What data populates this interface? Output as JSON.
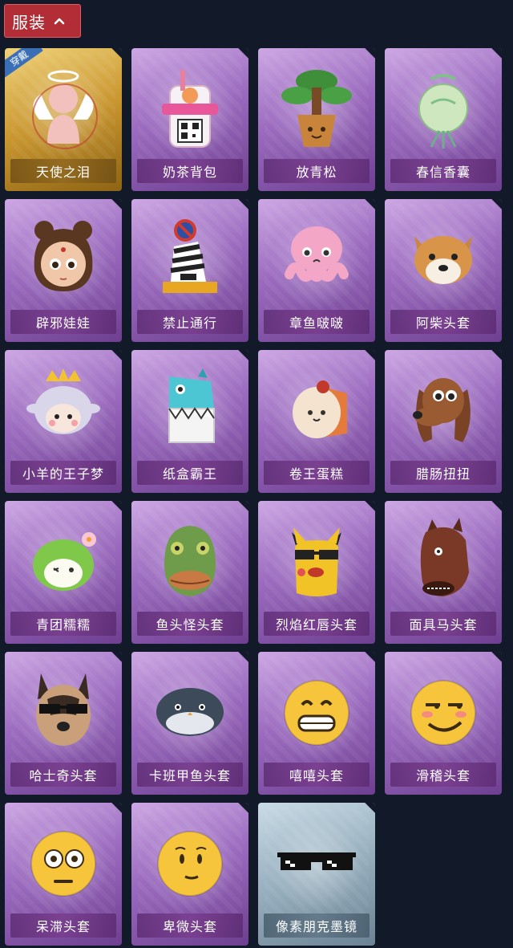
{
  "section": {
    "title": "服装",
    "icon": "chevron-up-icon"
  },
  "equipped_badge": "穿戴",
  "items": [
    {
      "label": "天使之泪",
      "icon": "angel-icon",
      "rarity": "gold",
      "equipped": true
    },
    {
      "label": "奶茶背包",
      "icon": "milk-tea-backpack-icon",
      "rarity": "purple"
    },
    {
      "label": "放青松",
      "icon": "pine-bonsai-icon",
      "rarity": "purple"
    },
    {
      "label": "春信香囊",
      "icon": "sachet-icon",
      "rarity": "purple"
    },
    {
      "label": "辟邪娃娃",
      "icon": "doll-icon",
      "rarity": "purple"
    },
    {
      "label": "禁止通行",
      "icon": "traffic-barrier-icon",
      "rarity": "purple"
    },
    {
      "label": "章鱼啵啵",
      "icon": "octopus-icon",
      "rarity": "purple"
    },
    {
      "label": "阿柴头套",
      "icon": "shiba-head-icon",
      "rarity": "purple"
    },
    {
      "label": "小羊的王子梦",
      "icon": "sheep-prince-icon",
      "rarity": "purple"
    },
    {
      "label": "纸盒霸王",
      "icon": "cardboard-dino-icon",
      "rarity": "purple"
    },
    {
      "label": "卷王蛋糕",
      "icon": "swiss-roll-icon",
      "rarity": "purple"
    },
    {
      "label": "腊肠扭扭",
      "icon": "dachshund-icon",
      "rarity": "purple"
    },
    {
      "label": "青团糯糯",
      "icon": "green-dumpling-icon",
      "rarity": "purple"
    },
    {
      "label": "鱼头怪头套",
      "icon": "fish-head-icon",
      "rarity": "purple"
    },
    {
      "label": "烈焰红唇头套",
      "icon": "pikachu-lips-icon",
      "rarity": "purple"
    },
    {
      "label": "面具马头套",
      "icon": "horse-head-icon",
      "rarity": "purple"
    },
    {
      "label": "哈士奇头套",
      "icon": "husky-head-icon",
      "rarity": "purple"
    },
    {
      "label": "卡班甲鱼头套",
      "icon": "fish-blob-icon",
      "rarity": "purple"
    },
    {
      "label": "嘻嘻头套",
      "icon": "grin-emoji-icon",
      "rarity": "purple"
    },
    {
      "label": "滑稽头套",
      "icon": "smirk-emoji-icon",
      "rarity": "purple"
    },
    {
      "label": "呆滞头套",
      "icon": "stare-emoji-icon",
      "rarity": "purple"
    },
    {
      "label": "卑微头套",
      "icon": "humble-emoji-icon",
      "rarity": "purple"
    },
    {
      "label": "像素朋克墨镜",
      "icon": "pixel-sunglasses-icon",
      "rarity": "silver"
    }
  ],
  "colors": {
    "background": "#121a2a",
    "header": "#b32d36",
    "purple_card": "#9b6bbf",
    "gold_card": "#c9962f",
    "silver_card": "#96aebd"
  }
}
